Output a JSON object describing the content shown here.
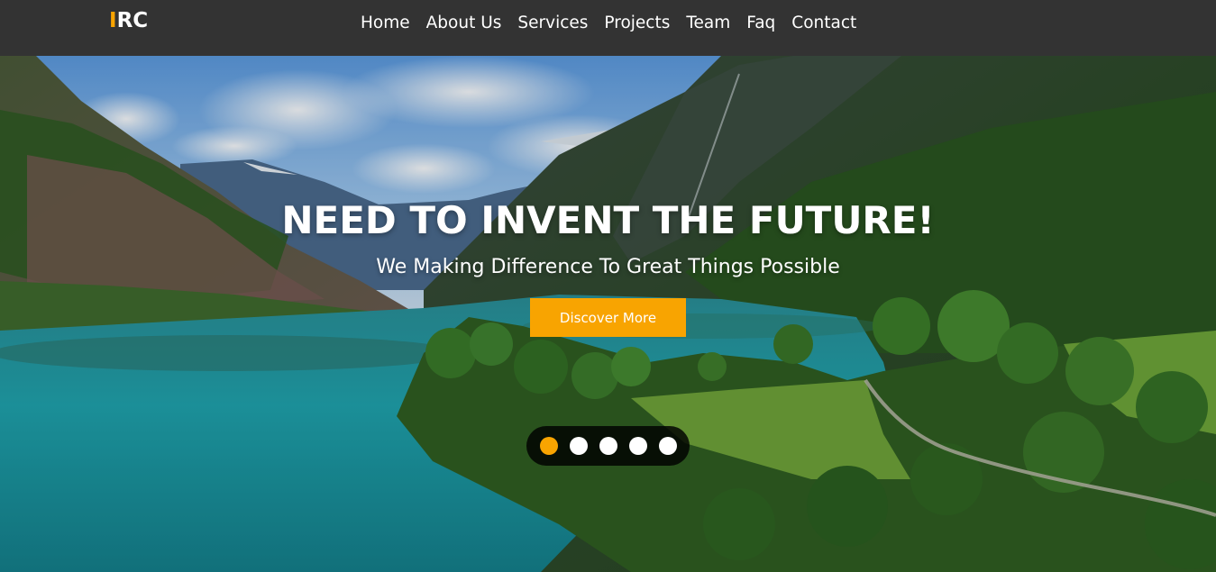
{
  "brand": {
    "accent_letter": "I",
    "rest": "RC",
    "accent_color": "#f8a401"
  },
  "nav": {
    "items": [
      "Home",
      "About Us",
      "Services",
      "Projects",
      "Team",
      "Faq",
      "Contact"
    ]
  },
  "hero": {
    "headline": "NEED TO INVENT THE FUTURE!",
    "subheadline": "We Making Difference To Great Things Possible",
    "cta_label": "Discover More",
    "background_scene": "mountain-lake-landscape",
    "carousel": {
      "slide_count": 5,
      "active_index": 0
    }
  },
  "colors": {
    "navbar_bg": "#333333",
    "accent": "#f8a401",
    "text": "#ffffff"
  }
}
